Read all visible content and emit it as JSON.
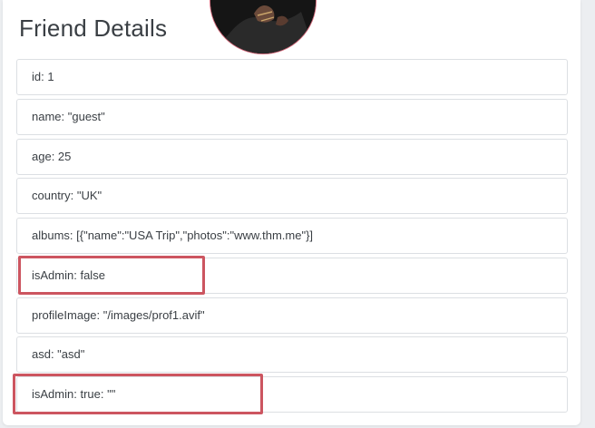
{
  "page": {
    "title": "Friend Details"
  },
  "avatar": {
    "icon": "profile-photo",
    "border_color": "#d36a7c"
  },
  "fields": [
    {
      "label": "id: 1"
    },
    {
      "label": "name: \"guest\""
    },
    {
      "label": "age: 25"
    },
    {
      "label": "country: \"UK\""
    },
    {
      "label": "albums: [{\"name\":\"USA Trip\",\"photos\":\"www.thm.me\"}]"
    },
    {
      "label": "isAdmin: false"
    },
    {
      "label": "profileImage: \"/images/prof1.avif\""
    },
    {
      "label": "asd: \"asd\""
    },
    {
      "label": "isAdmin: true: \"\""
    }
  ],
  "colors": {
    "highlight": "#cc5560",
    "text": "#3a3f44"
  }
}
